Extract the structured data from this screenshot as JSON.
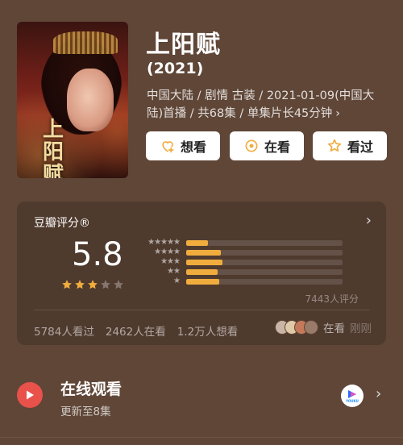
{
  "movie": {
    "title": "上阳赋",
    "year": "(2021)",
    "meta_line1": "中国大陆 / 剧情 古装 / 2021-01-09(中国大",
    "meta_line2": "陆)首播 / 共68集 / 单集片长45分钟",
    "meta_chevron": "›",
    "poster_text": "上\n阳\n赋"
  },
  "actions": {
    "want": "想看",
    "watching": "在看",
    "watched": "看过"
  },
  "rating": {
    "title": "豆瓣评分®",
    "score": "5.8",
    "stars_filled": 3,
    "stars_total": 5,
    "distribution_labels": [
      "★★★★★",
      "★★★★",
      "★★★",
      "★★",
      "★"
    ],
    "distribution": [
      0.14,
      0.22,
      0.23,
      0.2,
      0.21
    ],
    "raters": "7443人评分",
    "watched_count": "5784人看过",
    "watching_count": "2462人在看",
    "want_count": "1.2万人想看",
    "now_watching_label": "在看",
    "now_watching_time": "刚刚"
  },
  "online": {
    "title": "在线观看",
    "subtitle": "更新至8集",
    "provider_logo": "YOUKU"
  },
  "colors": {
    "background": "#5f4637",
    "star": "#f0ad3e",
    "play": "#e9514b"
  }
}
